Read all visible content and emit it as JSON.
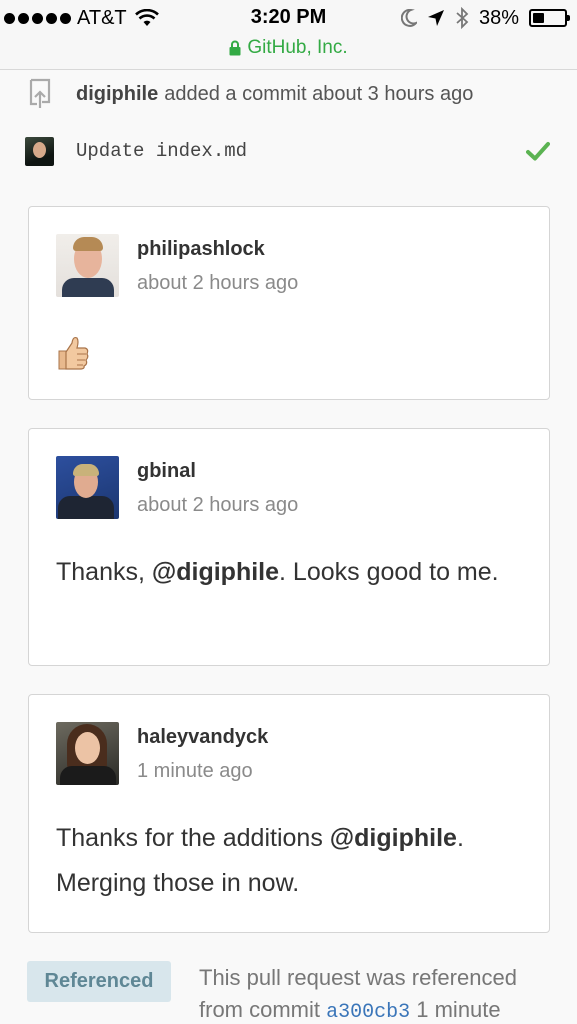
{
  "status_bar": {
    "carrier": "AT&T",
    "time": "3:20 PM",
    "battery": "38%",
    "battery_level": 0.38,
    "url": "GitHub, Inc."
  },
  "event": {
    "actor": "digiphile",
    "action": "added a commit about 3 hours ago"
  },
  "commit": {
    "message": "Update index.md",
    "status_icon": "check-icon",
    "status_color": "#5bb352"
  },
  "comments": [
    {
      "author": "philipashlock",
      "time": "about 2 hours ago",
      "body_emoji": "thumbs-up-icon"
    },
    {
      "author": "gbinal",
      "time": "about 2 hours ago",
      "body_pre": "Thanks, ",
      "mention": "@digiphile",
      "body_post": ". Looks good to me."
    },
    {
      "author": "haleyvandyck",
      "time": "1 minute ago",
      "body_pre": "Thanks for the additions ",
      "mention": "@digiphile",
      "body_post": ". Merging those in now."
    }
  ],
  "reference": {
    "badge": "Referenced",
    "text_pre": "This pull request was referenced from commit ",
    "sha": "a300cb3",
    "text_post": " 1 minute"
  },
  "colors": {
    "secure_url": "#33aa44",
    "link": "#3b76b9",
    "badge_bg": "#d8e6ec"
  }
}
